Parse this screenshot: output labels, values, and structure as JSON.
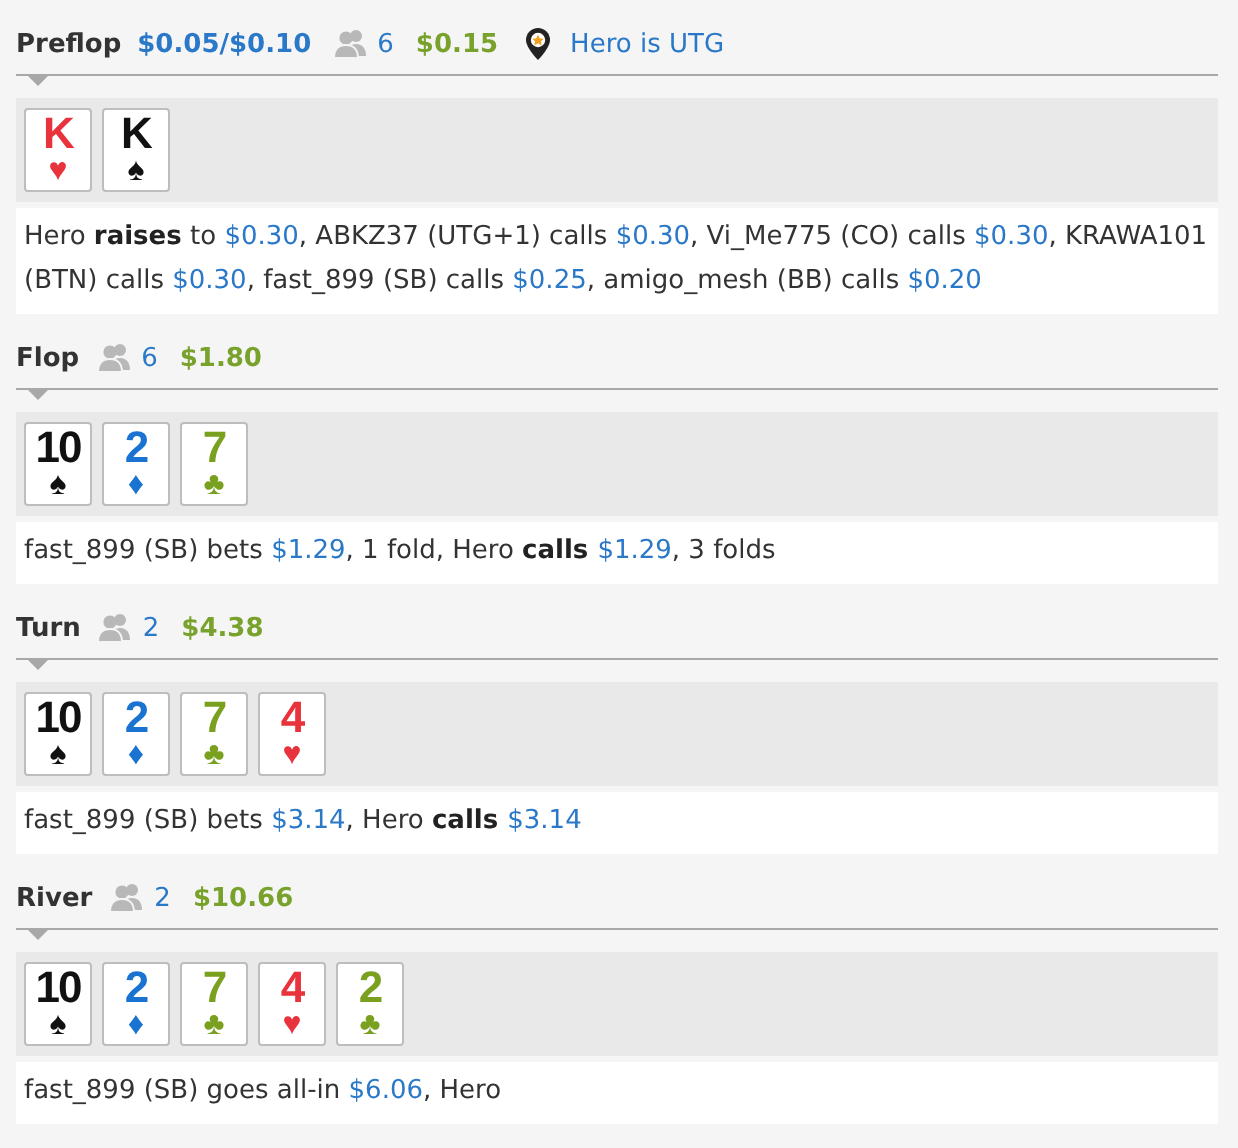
{
  "streets": [
    {
      "name": "Preflop",
      "blinds": "$0.05/$0.10",
      "players": "6",
      "pot": "$0.15",
      "hero_position": "Hero is UTG",
      "cards": [
        {
          "rank": "K",
          "suit": "♥",
          "color": "#e8323c"
        },
        {
          "rank": "K",
          "suit": "♠",
          "color": "#111111"
        }
      ],
      "action": [
        {
          "kind": "plain",
          "text": "Hero "
        },
        {
          "kind": "bold",
          "text": "raises"
        },
        {
          "kind": "plain",
          "text": " to "
        },
        {
          "kind": "amount",
          "text": "$0.30"
        },
        {
          "kind": "plain",
          "text": ", ABKZ37 (UTG+1) calls "
        },
        {
          "kind": "amount",
          "text": "$0.30"
        },
        {
          "kind": "plain",
          "text": ", Vi_Me775 (CO) calls "
        },
        {
          "kind": "amount",
          "text": "$0.30"
        },
        {
          "kind": "plain",
          "text": ", KRAWA101 (BTN) calls "
        },
        {
          "kind": "amount",
          "text": "$0.30"
        },
        {
          "kind": "plain",
          "text": ", fast_899 (SB) calls "
        },
        {
          "kind": "amount",
          "text": "$0.25"
        },
        {
          "kind": "plain",
          "text": ", amigo_mesh (BB) calls "
        },
        {
          "kind": "amount",
          "text": "$0.20"
        }
      ]
    },
    {
      "name": "Flop",
      "players": "6",
      "pot": "$1.80",
      "cards": [
        {
          "rank": "10",
          "suit": "♠",
          "color": "#111111"
        },
        {
          "rank": "2",
          "suit": "♦",
          "color": "#1a73d0"
        },
        {
          "rank": "7",
          "suit": "♣",
          "color": "#7aa020"
        }
      ],
      "action": [
        {
          "kind": "plain",
          "text": "fast_899 (SB) bets "
        },
        {
          "kind": "amount",
          "text": "$1.29"
        },
        {
          "kind": "plain",
          "text": ", 1 fold, Hero "
        },
        {
          "kind": "bold",
          "text": "calls "
        },
        {
          "kind": "amount",
          "text": "$1.29"
        },
        {
          "kind": "plain",
          "text": ", 3 folds"
        }
      ]
    },
    {
      "name": "Turn",
      "players": "2",
      "pot": "$4.38",
      "cards": [
        {
          "rank": "10",
          "suit": "♠",
          "color": "#111111"
        },
        {
          "rank": "2",
          "suit": "♦",
          "color": "#1a73d0"
        },
        {
          "rank": "7",
          "suit": "♣",
          "color": "#7aa020"
        },
        {
          "rank": "4",
          "suit": "♥",
          "color": "#e8323c"
        }
      ],
      "action": [
        {
          "kind": "plain",
          "text": "fast_899 (SB) bets "
        },
        {
          "kind": "amount",
          "text": "$3.14"
        },
        {
          "kind": "plain",
          "text": ", Hero "
        },
        {
          "kind": "bold",
          "text": "calls "
        },
        {
          "kind": "amount",
          "text": "$3.14"
        }
      ]
    },
    {
      "name": "River",
      "players": "2",
      "pot": "$10.66",
      "cards": [
        {
          "rank": "10",
          "suit": "♠",
          "color": "#111111"
        },
        {
          "rank": "2",
          "suit": "♦",
          "color": "#1a73d0"
        },
        {
          "rank": "7",
          "suit": "♣",
          "color": "#7aa020"
        },
        {
          "rank": "4",
          "suit": "♥",
          "color": "#e8323c"
        },
        {
          "rank": "2",
          "suit": "♣",
          "color": "#7aa020"
        }
      ],
      "action": [
        {
          "kind": "plain",
          "text": "fast_899 (SB) goes all-in "
        },
        {
          "kind": "amount",
          "text": "$6.06"
        },
        {
          "kind": "plain",
          "text": ", Hero"
        }
      ]
    }
  ]
}
